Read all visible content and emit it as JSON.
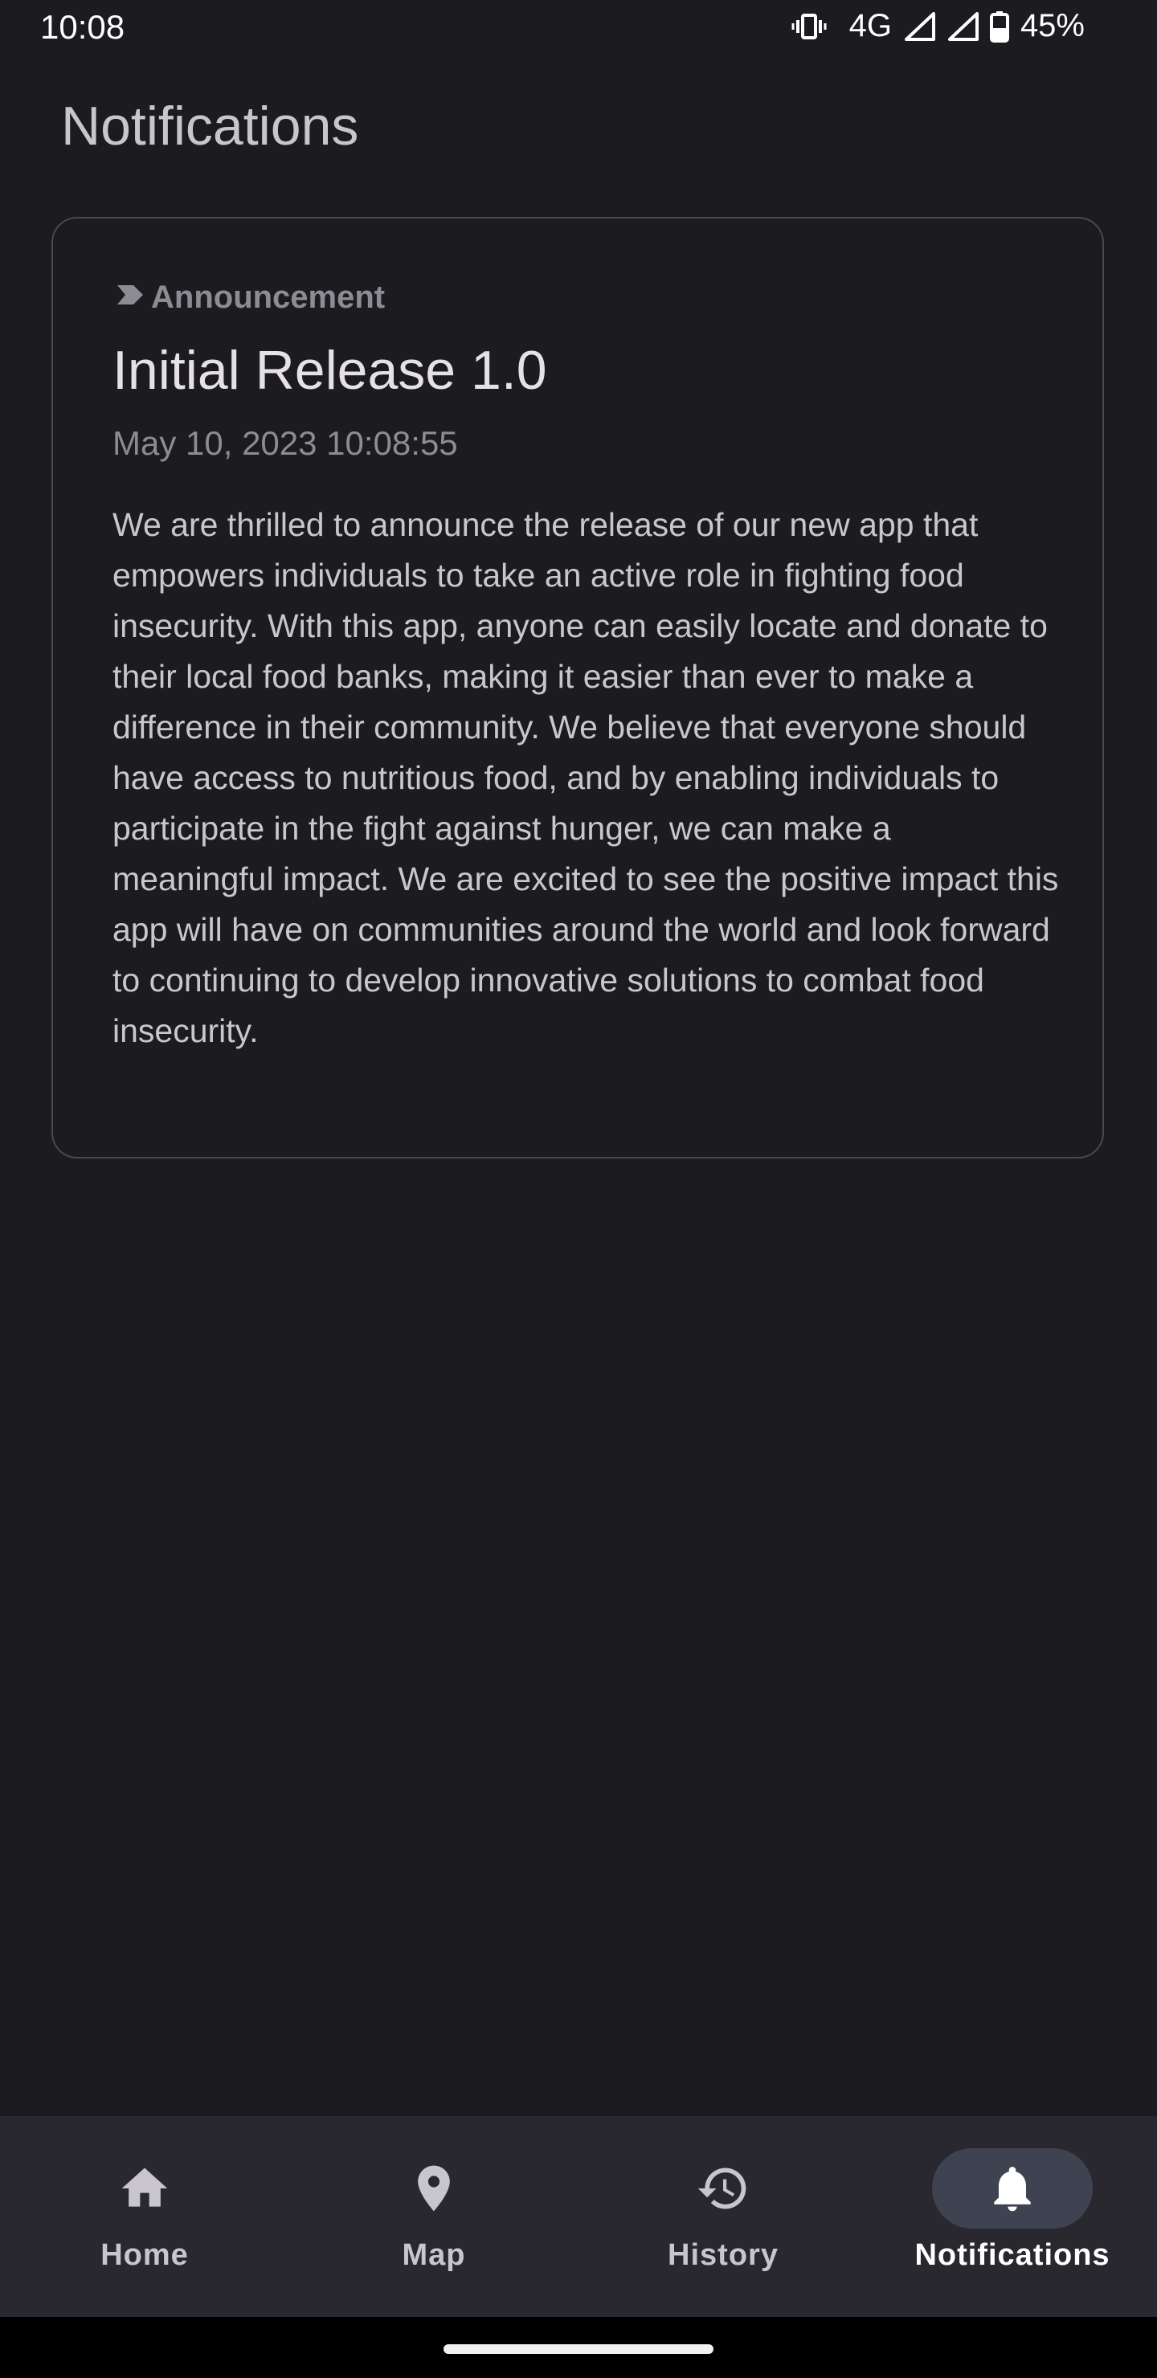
{
  "status_bar": {
    "time": "10:08",
    "network": "4G",
    "battery": "45%"
  },
  "page": {
    "title": "Notifications"
  },
  "notifications": [
    {
      "tag_icon": "label-icon",
      "tag": "Announcement",
      "title": "Initial Release 1.0",
      "date": "May 10, 2023 10:08:55",
      "body": "We are thrilled to announce the release of our new app that empowers individuals to take an active role in fighting food insecurity. With this app, anyone can easily locate and donate to their local food banks, making it easier than ever to make a difference in their community. We believe that everyone should have access to nutritious food, and by enabling individuals to participate in the fight against hunger, we can make a meaningful impact. We are excited to see the positive impact this app will have on communities around the world and look forward to continuing to develop innovative solutions to combat food insecurity."
    }
  ],
  "bottom_nav": {
    "items": [
      {
        "label": "Home",
        "icon": "home-icon",
        "active": false
      },
      {
        "label": "Map",
        "icon": "map-pin-icon",
        "active": false
      },
      {
        "label": "History",
        "icon": "history-icon",
        "active": false
      },
      {
        "label": "Notifications",
        "icon": "bell-icon",
        "active": true
      }
    ]
  },
  "colors": {
    "background": "#1c1b20",
    "nav_background": "#29282e",
    "active_indicator": "#3f4250"
  }
}
